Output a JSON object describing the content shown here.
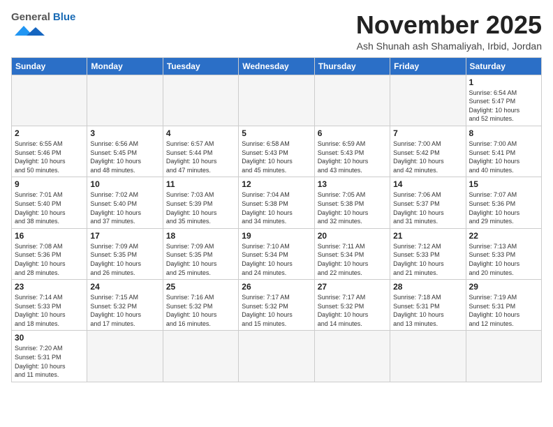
{
  "header": {
    "logo_general": "General",
    "logo_blue": "Blue",
    "month_title": "November 2025",
    "subtitle": "Ash Shunah ash Shamaliyah, Irbid, Jordan"
  },
  "weekdays": [
    "Sunday",
    "Monday",
    "Tuesday",
    "Wednesday",
    "Thursday",
    "Friday",
    "Saturday"
  ],
  "days": [
    {
      "date": "",
      "info": ""
    },
    {
      "date": "",
      "info": ""
    },
    {
      "date": "",
      "info": ""
    },
    {
      "date": "",
      "info": ""
    },
    {
      "date": "",
      "info": ""
    },
    {
      "date": "",
      "info": ""
    },
    {
      "date": "1",
      "info": "Sunrise: 6:54 AM\nSunset: 5:47 PM\nDaylight: 10 hours\nand 52 minutes."
    },
    {
      "date": "2",
      "info": "Sunrise: 6:55 AM\nSunset: 5:46 PM\nDaylight: 10 hours\nand 50 minutes."
    },
    {
      "date": "3",
      "info": "Sunrise: 6:56 AM\nSunset: 5:45 PM\nDaylight: 10 hours\nand 48 minutes."
    },
    {
      "date": "4",
      "info": "Sunrise: 6:57 AM\nSunset: 5:44 PM\nDaylight: 10 hours\nand 47 minutes."
    },
    {
      "date": "5",
      "info": "Sunrise: 6:58 AM\nSunset: 5:43 PM\nDaylight: 10 hours\nand 45 minutes."
    },
    {
      "date": "6",
      "info": "Sunrise: 6:59 AM\nSunset: 5:43 PM\nDaylight: 10 hours\nand 43 minutes."
    },
    {
      "date": "7",
      "info": "Sunrise: 7:00 AM\nSunset: 5:42 PM\nDaylight: 10 hours\nand 42 minutes."
    },
    {
      "date": "8",
      "info": "Sunrise: 7:00 AM\nSunset: 5:41 PM\nDaylight: 10 hours\nand 40 minutes."
    },
    {
      "date": "9",
      "info": "Sunrise: 7:01 AM\nSunset: 5:40 PM\nDaylight: 10 hours\nand 38 minutes."
    },
    {
      "date": "10",
      "info": "Sunrise: 7:02 AM\nSunset: 5:40 PM\nDaylight: 10 hours\nand 37 minutes."
    },
    {
      "date": "11",
      "info": "Sunrise: 7:03 AM\nSunset: 5:39 PM\nDaylight: 10 hours\nand 35 minutes."
    },
    {
      "date": "12",
      "info": "Sunrise: 7:04 AM\nSunset: 5:38 PM\nDaylight: 10 hours\nand 34 minutes."
    },
    {
      "date": "13",
      "info": "Sunrise: 7:05 AM\nSunset: 5:38 PM\nDaylight: 10 hours\nand 32 minutes."
    },
    {
      "date": "14",
      "info": "Sunrise: 7:06 AM\nSunset: 5:37 PM\nDaylight: 10 hours\nand 31 minutes."
    },
    {
      "date": "15",
      "info": "Sunrise: 7:07 AM\nSunset: 5:36 PM\nDaylight: 10 hours\nand 29 minutes."
    },
    {
      "date": "16",
      "info": "Sunrise: 7:08 AM\nSunset: 5:36 PM\nDaylight: 10 hours\nand 28 minutes."
    },
    {
      "date": "17",
      "info": "Sunrise: 7:09 AM\nSunset: 5:35 PM\nDaylight: 10 hours\nand 26 minutes."
    },
    {
      "date": "18",
      "info": "Sunrise: 7:09 AM\nSunset: 5:35 PM\nDaylight: 10 hours\nand 25 minutes."
    },
    {
      "date": "19",
      "info": "Sunrise: 7:10 AM\nSunset: 5:34 PM\nDaylight: 10 hours\nand 24 minutes."
    },
    {
      "date": "20",
      "info": "Sunrise: 7:11 AM\nSunset: 5:34 PM\nDaylight: 10 hours\nand 22 minutes."
    },
    {
      "date": "21",
      "info": "Sunrise: 7:12 AM\nSunset: 5:33 PM\nDaylight: 10 hours\nand 21 minutes."
    },
    {
      "date": "22",
      "info": "Sunrise: 7:13 AM\nSunset: 5:33 PM\nDaylight: 10 hours\nand 20 minutes."
    },
    {
      "date": "23",
      "info": "Sunrise: 7:14 AM\nSunset: 5:33 PM\nDaylight: 10 hours\nand 18 minutes."
    },
    {
      "date": "24",
      "info": "Sunrise: 7:15 AM\nSunset: 5:32 PM\nDaylight: 10 hours\nand 17 minutes."
    },
    {
      "date": "25",
      "info": "Sunrise: 7:16 AM\nSunset: 5:32 PM\nDaylight: 10 hours\nand 16 minutes."
    },
    {
      "date": "26",
      "info": "Sunrise: 7:17 AM\nSunset: 5:32 PM\nDaylight: 10 hours\nand 15 minutes."
    },
    {
      "date": "27",
      "info": "Sunrise: 7:17 AM\nSunset: 5:32 PM\nDaylight: 10 hours\nand 14 minutes."
    },
    {
      "date": "28",
      "info": "Sunrise: 7:18 AM\nSunset: 5:31 PM\nDaylight: 10 hours\nand 13 minutes."
    },
    {
      "date": "29",
      "info": "Sunrise: 7:19 AM\nSunset: 5:31 PM\nDaylight: 10 hours\nand 12 minutes."
    },
    {
      "date": "30",
      "info": "Sunrise: 7:20 AM\nSunset: 5:31 PM\nDaylight: 10 hours\nand 11 minutes."
    },
    {
      "date": "",
      "info": ""
    },
    {
      "date": "",
      "info": ""
    },
    {
      "date": "",
      "info": ""
    },
    {
      "date": "",
      "info": ""
    },
    {
      "date": "",
      "info": ""
    },
    {
      "date": "",
      "info": ""
    }
  ]
}
